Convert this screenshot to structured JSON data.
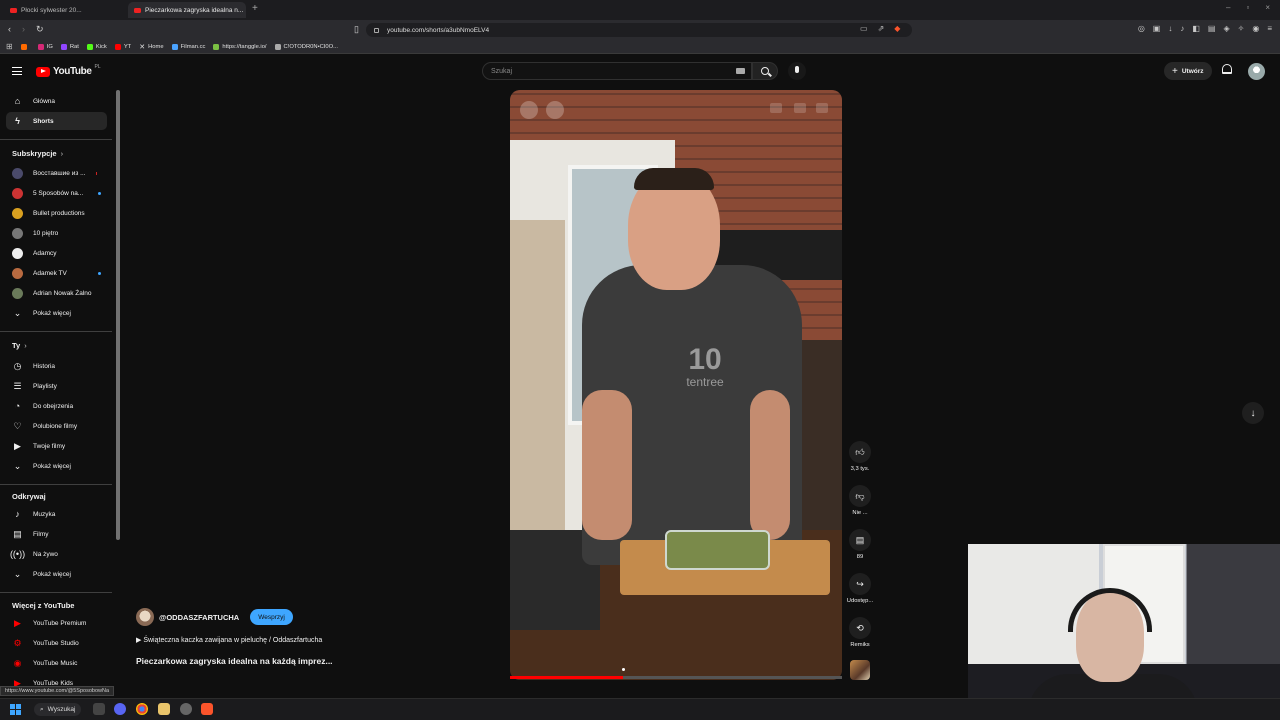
{
  "browser": {
    "tabs": [
      {
        "title": "Płocki sylwester 20...",
        "active": false
      },
      {
        "title": "Pieczarkowa zagryska idealna n...",
        "active": true
      }
    ],
    "new_tab_icon": "plus-icon",
    "url": "youtube.com/shorts/a3ubNmoELV4",
    "bookmarks": [
      {
        "label": "",
        "color": "#ff6a00"
      },
      {
        "label": "IG",
        "color": "#d62976"
      },
      {
        "label": "Rat",
        "color": "#9146ff"
      },
      {
        "label": "Kick",
        "color": "#53fc18"
      },
      {
        "label": "YT",
        "color": "#ff0000"
      },
      {
        "label": "Home",
        "color": "#ffffff"
      },
      {
        "label": "Filman.cc",
        "color": "#4aa3ff"
      },
      {
        "label": "https://tanggle.io/",
        "color": "#7bc043"
      },
      {
        "label": "C!OTODR0N•CI0O...",
        "color": "#aaaaaa"
      }
    ]
  },
  "header": {
    "logo_text": "YouTube",
    "logo_region": "PL",
    "search_placeholder": "Szukaj",
    "create_label": "Utwórz"
  },
  "sidebar": {
    "main": [
      {
        "label": "Główna",
        "icon": "home-icon",
        "active": false
      },
      {
        "label": "Shorts",
        "icon": "shorts-icon",
        "active": true
      }
    ],
    "subscriptions_title": "Subskrypcje",
    "subscriptions": [
      {
        "label": "Восставшие из ...",
        "avatar": "#4a4a6a",
        "badge": "live"
      },
      {
        "label": "5 Sposobów na...",
        "avatar": "#c33",
        "badge": "dot"
      },
      {
        "label": "Bullet productions",
        "avatar": "#d9a020",
        "badge": ""
      },
      {
        "label": "10 piętro",
        "avatar": "#777",
        "badge": ""
      },
      {
        "label": "Adamcy",
        "avatar": "#eee",
        "badge": ""
      },
      {
        "label": "Adamek TV",
        "avatar": "#b86a40",
        "badge": "dot"
      },
      {
        "label": "Adrian Nowak Żalno",
        "avatar": "#6a7a5a",
        "badge": ""
      }
    ],
    "subs_more": "Pokaż więcej",
    "you_title": "Ty",
    "you": [
      {
        "label": "Historia",
        "icon": "history-icon"
      },
      {
        "label": "Playlisty",
        "icon": "playlist-icon"
      },
      {
        "label": "Do obejrzenia",
        "icon": "watch-later-icon"
      },
      {
        "label": "Polubione filmy",
        "icon": "like-icon"
      },
      {
        "label": "Twoje filmy",
        "icon": "your-videos-icon"
      }
    ],
    "you_more": "Pokaż więcej",
    "explore_title": "Odkrywaj",
    "explore": [
      {
        "label": "Muzyka",
        "icon": "music-icon"
      },
      {
        "label": "Filmy",
        "icon": "film-icon"
      },
      {
        "label": "Na żywo",
        "icon": "live-icon"
      }
    ],
    "explore_more": "Pokaż więcej",
    "more_title": "Więcej z YouTube",
    "more": [
      {
        "label": "YouTube Premium"
      },
      {
        "label": "YouTube Studio"
      },
      {
        "label": "YouTube Music"
      },
      {
        "label": "YouTube Kids"
      }
    ]
  },
  "short": {
    "channel": "@ODDASZFARTUCHA",
    "support_label": "Wesprzyj",
    "related": "▶ Świąteczna kaczka zawijana w pieluchę / Oddaszfartucha",
    "title": "Pieczarkowa zagryska idealna na każdą imprez...",
    "video_brand_big": "10",
    "video_brand_small": "tentree",
    "progress_fraction": 0.34,
    "actions": [
      {
        "icon": "thumbs-up-icon",
        "label": "3,3 tys."
      },
      {
        "icon": "thumbs-down-icon",
        "label": "Nie ..."
      },
      {
        "icon": "comments-icon",
        "label": "89"
      },
      {
        "icon": "share-icon",
        "label": "Udostęp..."
      },
      {
        "icon": "remix-icon",
        "label": "Remiks"
      }
    ]
  },
  "status_url": "https://www.youtube.com/@5SposobowNa",
  "taskbar": {
    "search_label": "Wyszukaj"
  }
}
